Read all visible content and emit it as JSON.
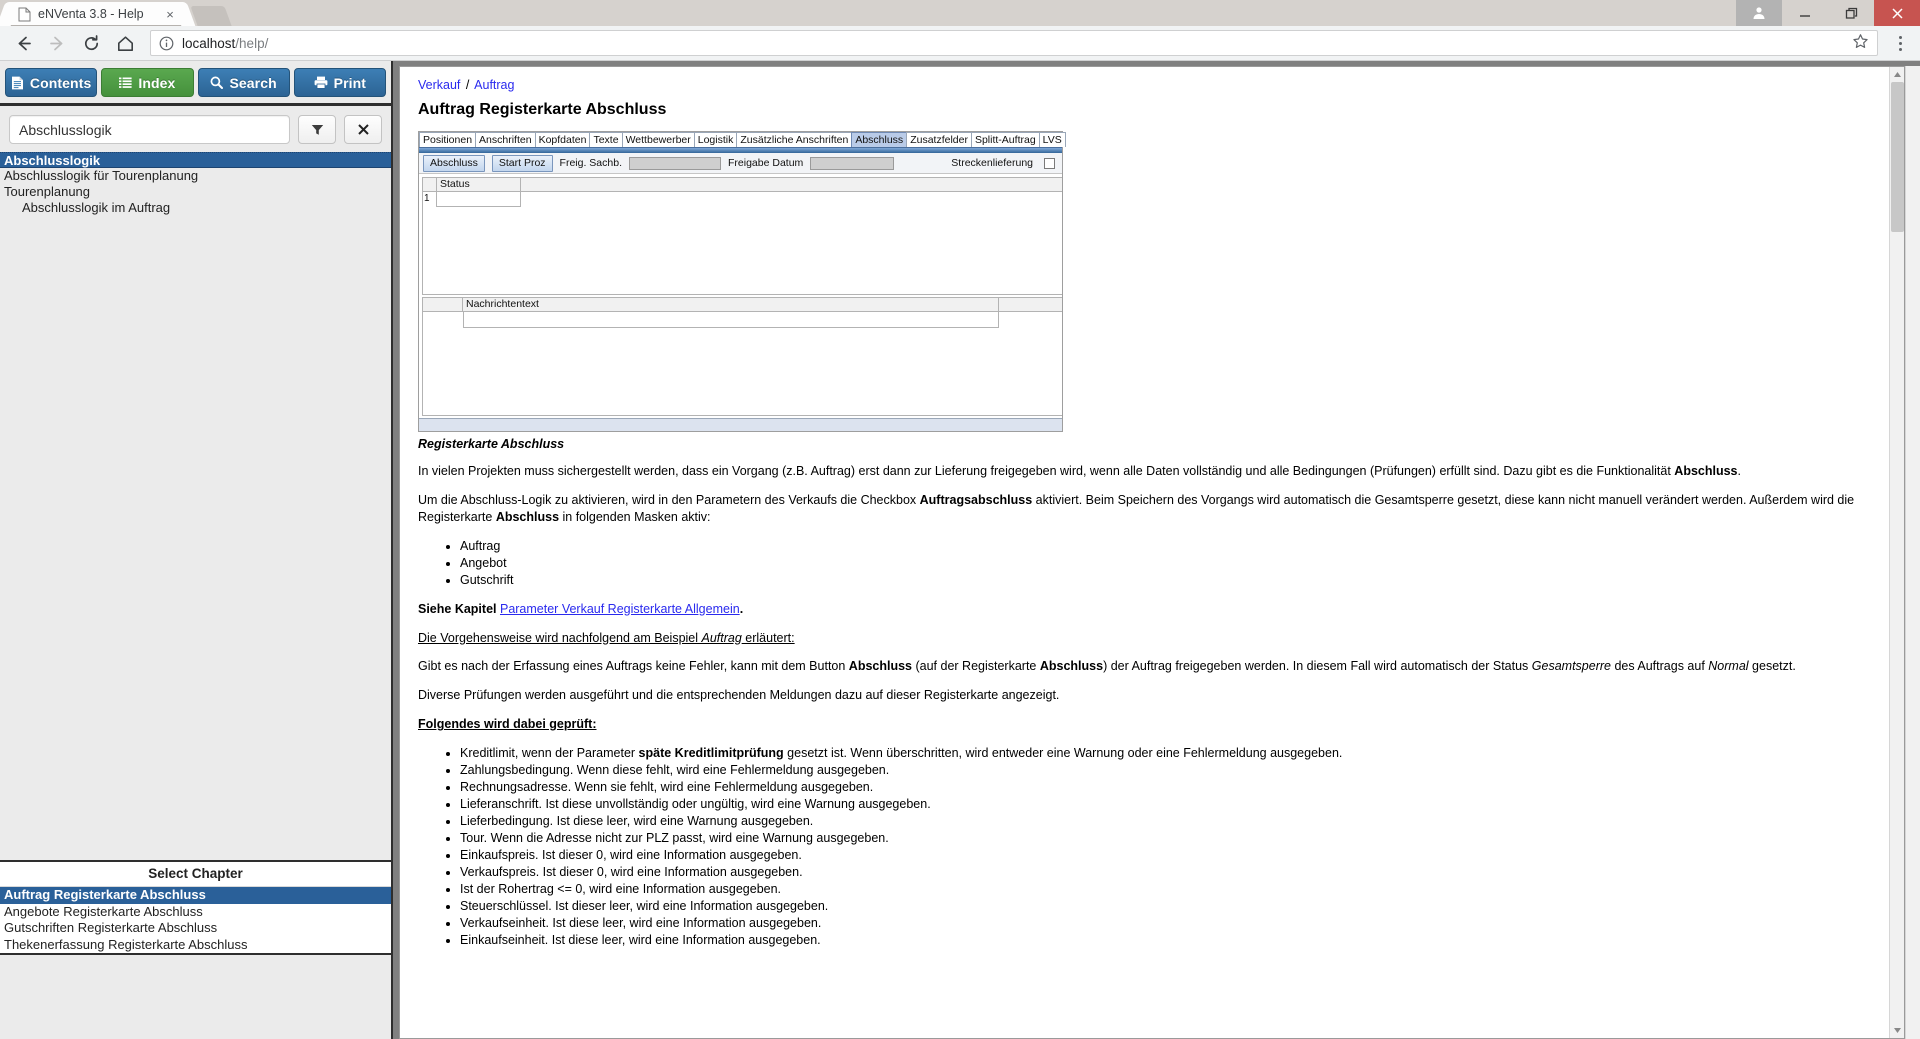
{
  "browser": {
    "tab_title": "eNVenta 3.8 - Help",
    "tab_close": "×",
    "url_host": "localhost",
    "url_path": "/help/"
  },
  "help_toolbar": {
    "contents": "Contents",
    "index": "Index",
    "search": "Search",
    "print": "Print"
  },
  "search": {
    "value": "Abschlusslogik",
    "placeholder": "",
    "filter_label": "",
    "clear_label": "✕"
  },
  "results": [
    {
      "label": "Abschlusslogik",
      "selected": true,
      "indent": false
    },
    {
      "label": "Abschlusslogik für Tourenplanung",
      "selected": false,
      "indent": false
    },
    {
      "label": "Tourenplanung",
      "selected": false,
      "indent": false
    },
    {
      "label": "Abschlusslogik im Auftrag",
      "selected": false,
      "indent": true
    }
  ],
  "chapter_panel": {
    "header": "Select Chapter",
    "items": [
      {
        "label": "Auftrag Registerkarte Abschluss",
        "selected": true
      },
      {
        "label": "Angebote Registerkarte Abschluss",
        "selected": false
      },
      {
        "label": "Gutschriften Registerkarte Abschluss",
        "selected": false
      },
      {
        "label": "Thekenerfassung Registerkarte Abschluss",
        "selected": false
      }
    ]
  },
  "document": {
    "breadcrumb": {
      "first": "Verkauf",
      "sep": "/",
      "second": "Auftrag"
    },
    "title": "Auftrag Registerkarte Abschluss",
    "caption": "Registerkarte Abschluss",
    "screenshot": {
      "tabs": [
        {
          "label": "Positionen",
          "active": false
        },
        {
          "label": "Anschriften",
          "active": false
        },
        {
          "label": "Kopfdaten",
          "active": false
        },
        {
          "label": "Texte",
          "active": false
        },
        {
          "label": "Wettbewerber",
          "active": false
        },
        {
          "label": "Logistik",
          "active": false
        },
        {
          "label": "Zusätzliche Anschriften",
          "active": false
        },
        {
          "label": "Abschluss",
          "active": true
        },
        {
          "label": "Zusatzfelder",
          "active": false
        },
        {
          "label": "Splitt-Auftrag",
          "active": false
        },
        {
          "label": "LVS",
          "active": false
        }
      ],
      "btn_abschluss": "Abschluss",
      "btn_startproz": "Start Proz",
      "lbl_freig_sachb": "Freig. Sachb.",
      "lbl_freigabe_datum": "Freigabe Datum",
      "lbl_streckenlieferung": "Streckenlieferung",
      "grid_col_status": "Status",
      "grid_row_number": "1",
      "grid2_col_nachrichtentext": "Nachrichtentext"
    },
    "paragraphs": {
      "p1_a": "In vielen Projekten muss sichergestellt werden, dass ein Vorgang (z.B. Auftrag) erst dann zur Lieferung freigegeben wird, wenn alle Daten vollständig und alle Bedingungen (Prüfungen) erfüllt sind. Dazu gibt es die Funktionalität ",
      "p1_b": "Abschluss",
      "p1_c": ".",
      "p2_a": "Um die Abschluss-Logik zu aktivieren, wird in den Parametern des Verkaufs die Checkbox ",
      "p2_b": "Auftragsabschluss",
      "p2_c": " aktiviert. Beim Speichern des Vorgangs wird automatisch die Gesamtsperre gesetzt, diese kann nicht manuell verändert werden. Außerdem wird die Registerkarte ",
      "p2_d": "Abschluss",
      "p2_e": " in folgenden Masken aktiv:",
      "masken": [
        "Auftrag",
        "Angebot",
        "Gutschrift"
      ],
      "p3_a": "Siehe Kapitel ",
      "p3_link": "Parameter Verkauf Registerkarte Allgemein",
      "p3_c": ".",
      "p4_a": "Die Vorgehensweise wird nachfolgend am Beispiel ",
      "p4_i": "Auftrag",
      "p4_c": " erläutert:",
      "p5_a": "Gibt es nach der Erfassung eines Auftrags keine Fehler, kann mit dem Button ",
      "p5_b": "Abschluss",
      "p5_c": " (auf der Registerkarte ",
      "p5_d": "Abschluss",
      "p5_e": ") der Auftrag freigegeben werden. In diesem Fall wird automatisch der Status ",
      "p5_f": "Gesamtsperre",
      "p5_g": " des Auftrags auf ",
      "p5_h": "Normal",
      "p5_i": " gesetzt.",
      "p6": "Diverse Prüfungen werden ausgeführt und die entsprechenden Meldungen dazu auf dieser Registerkarte angezeigt.",
      "p7": "Folgendes wird dabei geprüft:"
    },
    "checks": [
      {
        "a": "Kreditlimit, wenn der Parameter ",
        "b": "späte Kreditlimitprüfung",
        "c": " gesetzt ist. Wenn überschritten, wird entweder eine Warnung oder eine Fehlermeldung ausgegeben."
      },
      {
        "a": "Zahlungsbedingung. Wenn diese fehlt, wird eine Fehlermeldung ausgegeben.",
        "b": "",
        "c": ""
      },
      {
        "a": "Rechnungsadresse. Wenn sie fehlt, wird eine Fehlermeldung ausgegeben.",
        "b": "",
        "c": ""
      },
      {
        "a": "Lieferanschrift. Ist diese unvollständig oder ungültig, wird eine Warnung ausgegeben.",
        "b": "",
        "c": ""
      },
      {
        "a": "Lieferbedingung. Ist diese leer, wird eine Warnung ausgegeben.",
        "b": "",
        "c": ""
      },
      {
        "a": "Tour. Wenn die Adresse nicht zur PLZ passt, wird eine Warnung ausgegeben.",
        "b": "",
        "c": ""
      },
      {
        "a": "Einkaufspreis. Ist dieser 0, wird eine Information ausgegeben.",
        "b": "",
        "c": ""
      },
      {
        "a": "Verkaufspreis. Ist dieser 0, wird eine Information ausgegeben.",
        "b": "",
        "c": ""
      },
      {
        "a": "Ist der Rohertrag <= 0, wird eine Information ausgegeben.",
        "b": "",
        "c": ""
      },
      {
        "a": "Steuerschlüssel. Ist dieser leer, wird eine Information ausgegeben.",
        "b": "",
        "c": ""
      },
      {
        "a": "Verkaufseinheit. Ist diese leer, wird eine Information ausgegeben.",
        "b": "",
        "c": ""
      },
      {
        "a": "Einkaufseinheit. Ist diese leer, wird eine Information ausgegeben.",
        "b": "",
        "c": ""
      }
    ]
  }
}
